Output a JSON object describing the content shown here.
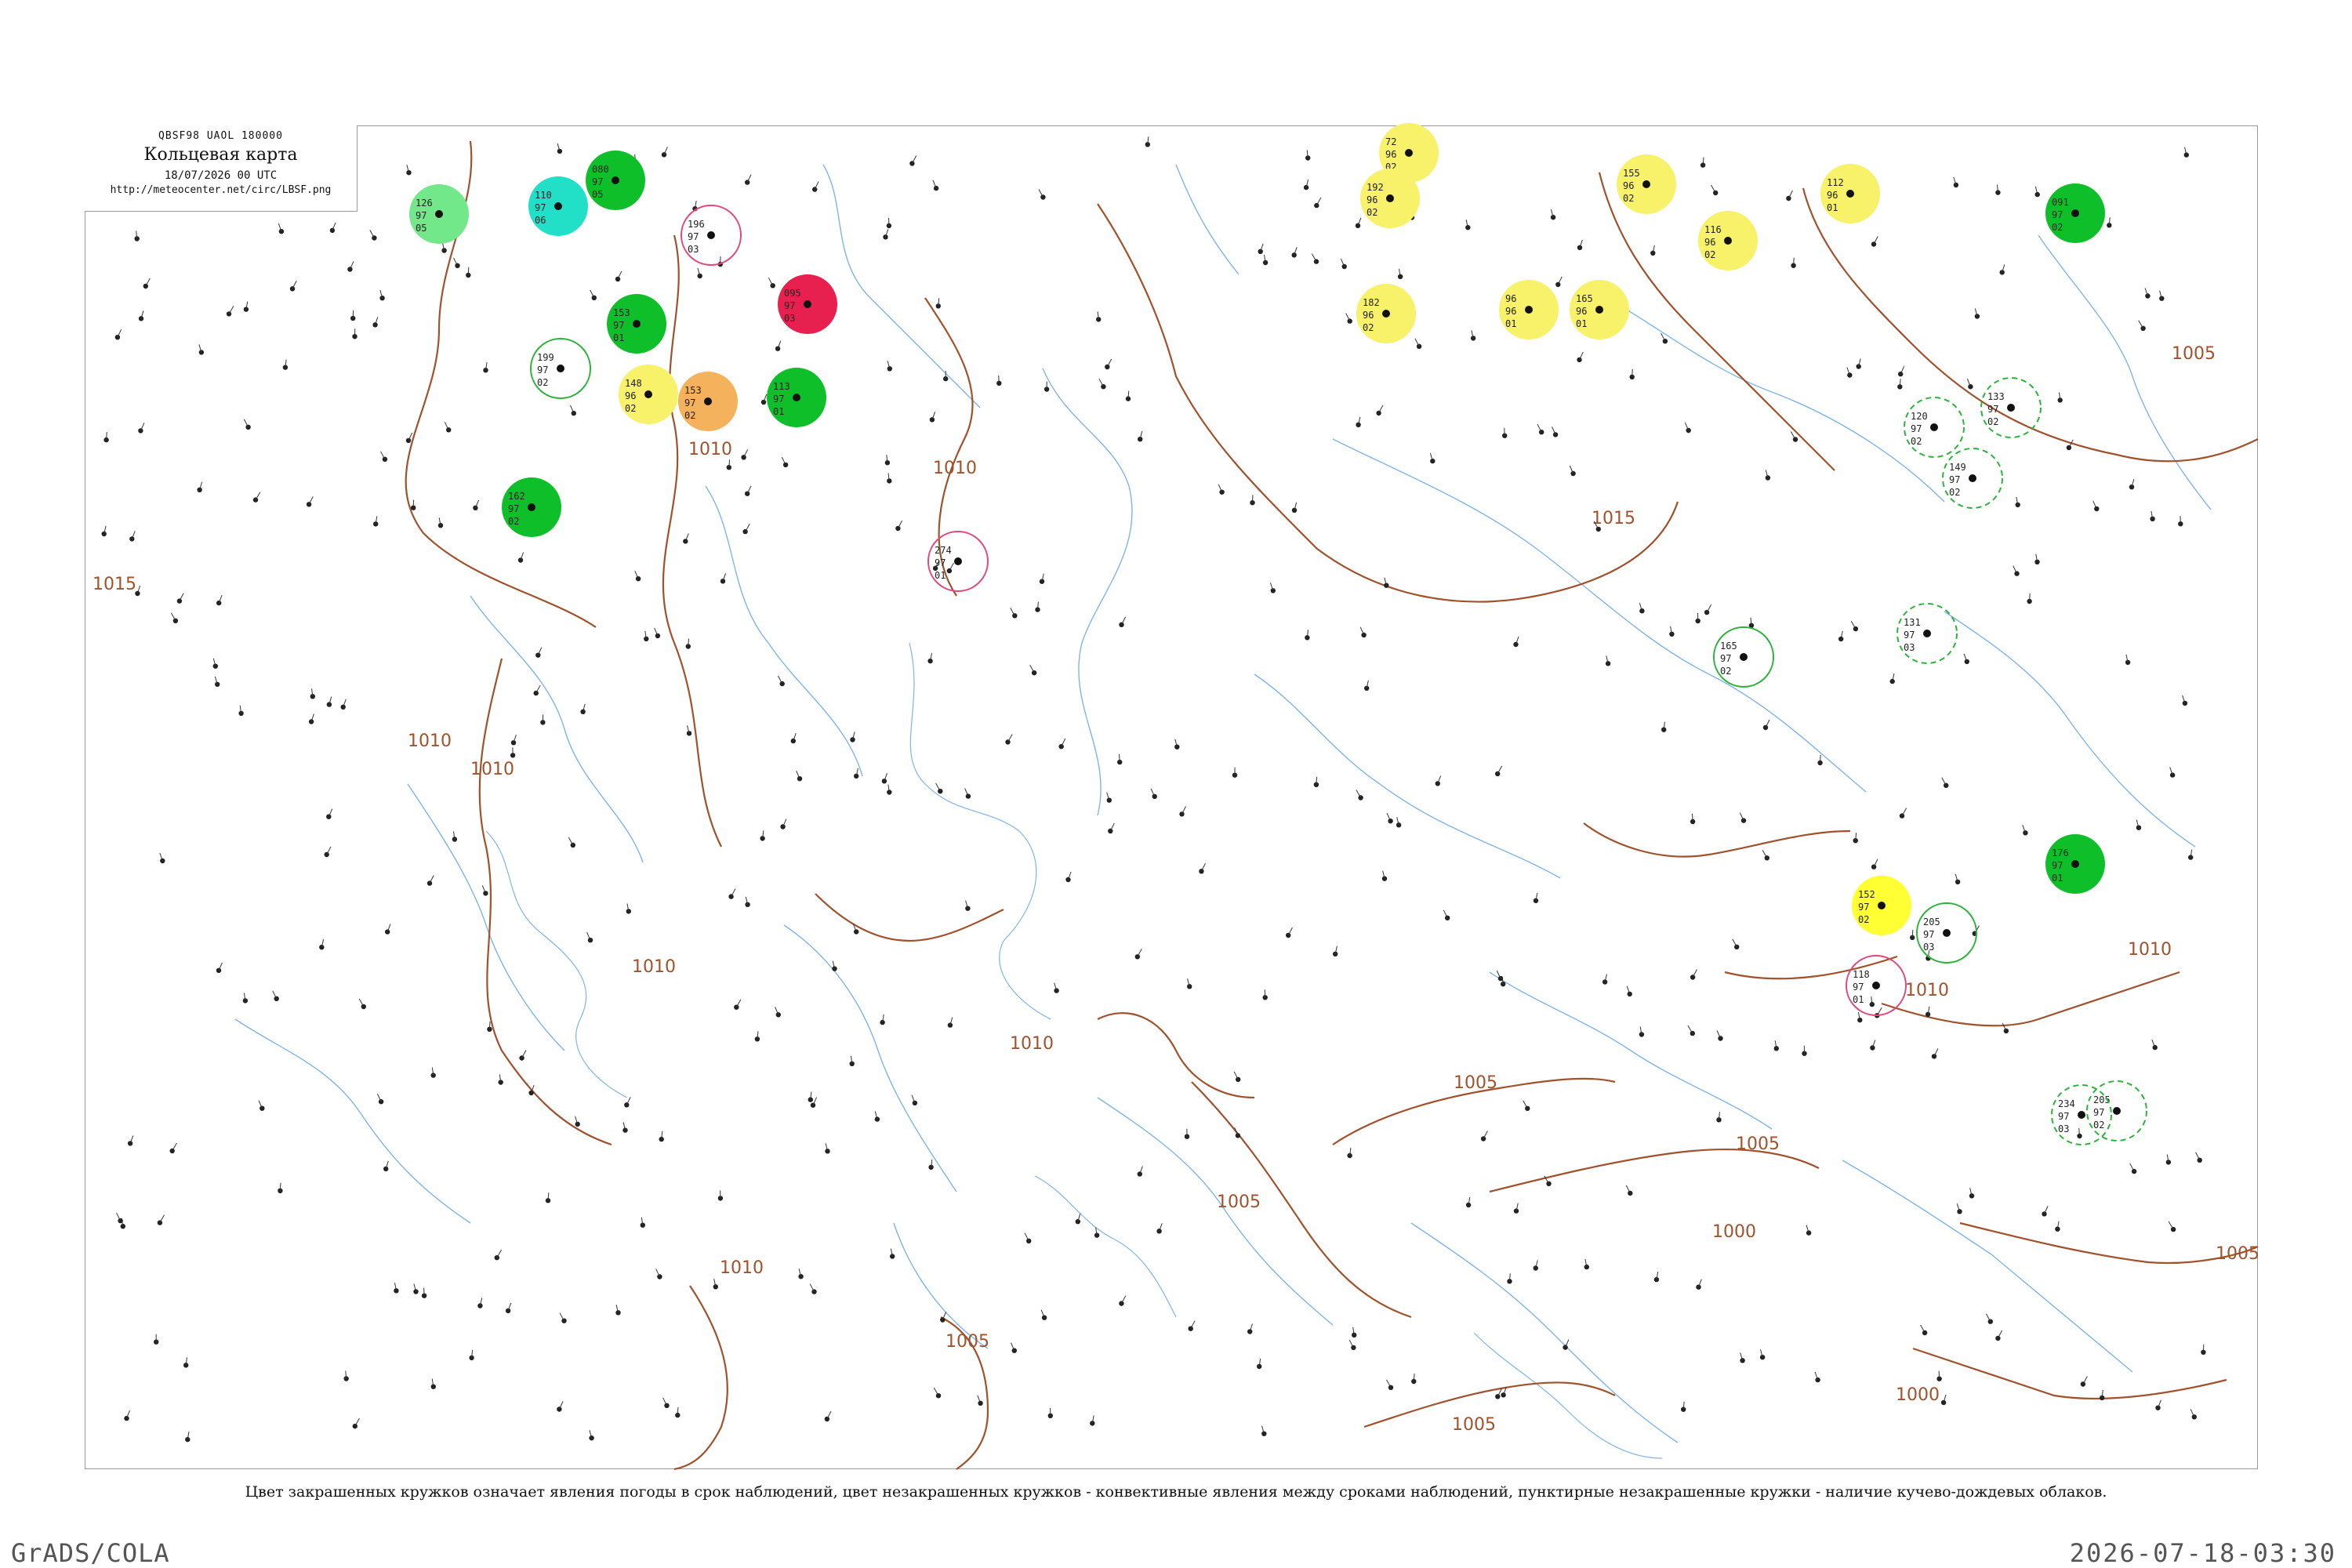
{
  "header": {
    "code": "QBSF98  UAOL  180000",
    "title": "Кольцевая карта",
    "date": "18/07/2026 00 UTC",
    "url": "http://meteocenter.net/circ/LBSF.png"
  },
  "caption": "Цвет закрашенных кружков означает явления погоды в срок наблюдений, цвет незакрашенных кружков - конвективные явления между сроками наблюдений, пунктирные незакрашенные кружки - наличие кучево-дождевых облаков.",
  "footer": {
    "software": "GrADS/COLA",
    "timestamp": "2026-07-18-03:30"
  },
  "colors": {
    "isobar": "#a0522d",
    "river": "#7fb4e6",
    "frame": "#9a9a9a",
    "station_text": "#222222",
    "rain_dark": "#0fbf2a",
    "rain_light": "#73e88a",
    "showers_cyan": "#22e0c8",
    "fog_yellow": "#f7f26a",
    "haze_yellow": "#ffff33",
    "orange": "#f4b25c",
    "thunder_red": "#e8204f",
    "convective_green_outline": "#2cb33c",
    "convective_red_outline": "#e04a7a"
  },
  "isobar_labels": [
    {
      "text": "1015"
    },
    {
      "text": "1010"
    },
    {
      "text": "1010"
    },
    {
      "text": "1010"
    },
    {
      "text": "1010"
    },
    {
      "text": "1015"
    },
    {
      "text": "1005"
    },
    {
      "text": "1010"
    },
    {
      "text": "1010"
    },
    {
      "text": "1005"
    },
    {
      "text": "1010"
    },
    {
      "text": "1010"
    },
    {
      "text": "1005"
    },
    {
      "text": "1000"
    },
    {
      "text": "1005"
    },
    {
      "text": "1005"
    },
    {
      "text": "1010"
    },
    {
      "text": "1005"
    },
    {
      "text": "1005"
    },
    {
      "text": "1000"
    }
  ],
  "stations": [
    {
      "top": "126",
      "mid": "97",
      "bot": "05",
      "phen": "rain_light",
      "circle": "filled"
    },
    {
      "top": "110",
      "mid": "97",
      "bot": "06",
      "phen": "showers_cyan",
      "circle": "filled"
    },
    {
      "top": "080",
      "mid": "97",
      "bot": "05",
      "phen": "rain_dark",
      "circle": "filled"
    },
    {
      "top": "095",
      "mid": "97",
      "bot": "03",
      "phen": "thunder_red",
      "circle": "filled"
    },
    {
      "top": "153",
      "mid": "97",
      "bot": "01",
      "phen": "rain_dark",
      "circle": "filled"
    },
    {
      "top": "148",
      "mid": "96",
      "bot": "02",
      "phen": "fog_yellow",
      "circle": "filled"
    },
    {
      "top": "153",
      "mid": "97",
      "bot": "02",
      "phen": "orange",
      "circle": "filled"
    },
    {
      "top": "113",
      "mid": "97",
      "bot": "01",
      "phen": "rain_dark",
      "circle": "filled"
    },
    {
      "top": "199",
      "mid": "97",
      "bot": "02",
      "phen": "green",
      "circle": "outline"
    },
    {
      "top": "196",
      "mid": "97",
      "bot": "03",
      "phen": "red",
      "circle": "outline"
    },
    {
      "top": "274",
      "mid": "97",
      "bot": "01",
      "phen": "red",
      "circle": "outline"
    },
    {
      "top": "72",
      "mid": "96",
      "bot": "02",
      "phen": "fog_yellow",
      "circle": "filled"
    },
    {
      "top": "192",
      "mid": "96",
      "bot": "02",
      "phen": "fog_yellow",
      "circle": "filled"
    },
    {
      "top": "96",
      "mid": "96",
      "bot": "01",
      "phen": "fog_yellow",
      "circle": "filled"
    },
    {
      "top": "182",
      "mid": "96",
      "bot": "02",
      "phen": "fog_yellow",
      "circle": "filled"
    },
    {
      "top": "165",
      "mid": "96",
      "bot": "01",
      "phen": "fog_yellow",
      "circle": "filled"
    },
    {
      "top": "155",
      "mid": "96",
      "bot": "02",
      "phen": "fog_yellow",
      "circle": "filled"
    },
    {
      "top": "116",
      "mid": "96",
      "bot": "02",
      "phen": "fog_yellow",
      "circle": "filled"
    },
    {
      "top": "112",
      "mid": "96",
      "bot": "01",
      "phen": "fog_yellow",
      "circle": "filled"
    },
    {
      "top": "091",
      "mid": "97",
      "bot": "02",
      "phen": "rain_dark",
      "circle": "filled"
    },
    {
      "top": "133",
      "mid": "97",
      "bot": "02",
      "phen": "green",
      "circle": "dashed"
    },
    {
      "top": "120",
      "mid": "97",
      "bot": "02",
      "phen": "green",
      "circle": "dashed"
    },
    {
      "top": "149",
      "mid": "97",
      "bot": "02",
      "phen": "green",
      "circle": "dashed"
    },
    {
      "top": "165",
      "mid": "97",
      "bot": "02",
      "phen": "green",
      "circle": "outline"
    },
    {
      "top": "131",
      "mid": "97",
      "bot": "03",
      "phen": "green",
      "circle": "dashed"
    },
    {
      "top": "152",
      "mid": "97",
      "bot": "02",
      "phen": "haze_yellow",
      "circle": "filled"
    },
    {
      "top": "205",
      "mid": "97",
      "bot": "03",
      "phen": "green",
      "circle": "outline"
    },
    {
      "top": "118",
      "mid": "97",
      "bot": "01",
      "phen": "red",
      "circle": "outline"
    },
    {
      "top": "176",
      "mid": "97",
      "bot": "01",
      "phen": "rain_dark",
      "circle": "filled"
    },
    {
      "top": "205",
      "mid": "97",
      "bot": "02",
      "phen": "green",
      "circle": "dashed"
    },
    {
      "top": "234",
      "mid": "97",
      "bot": "03",
      "phen": "green",
      "circle": "dashed"
    },
    {
      "top": "162",
      "mid": "97",
      "bot": "02",
      "phen": "rain_dark",
      "circle": "filled"
    }
  ]
}
